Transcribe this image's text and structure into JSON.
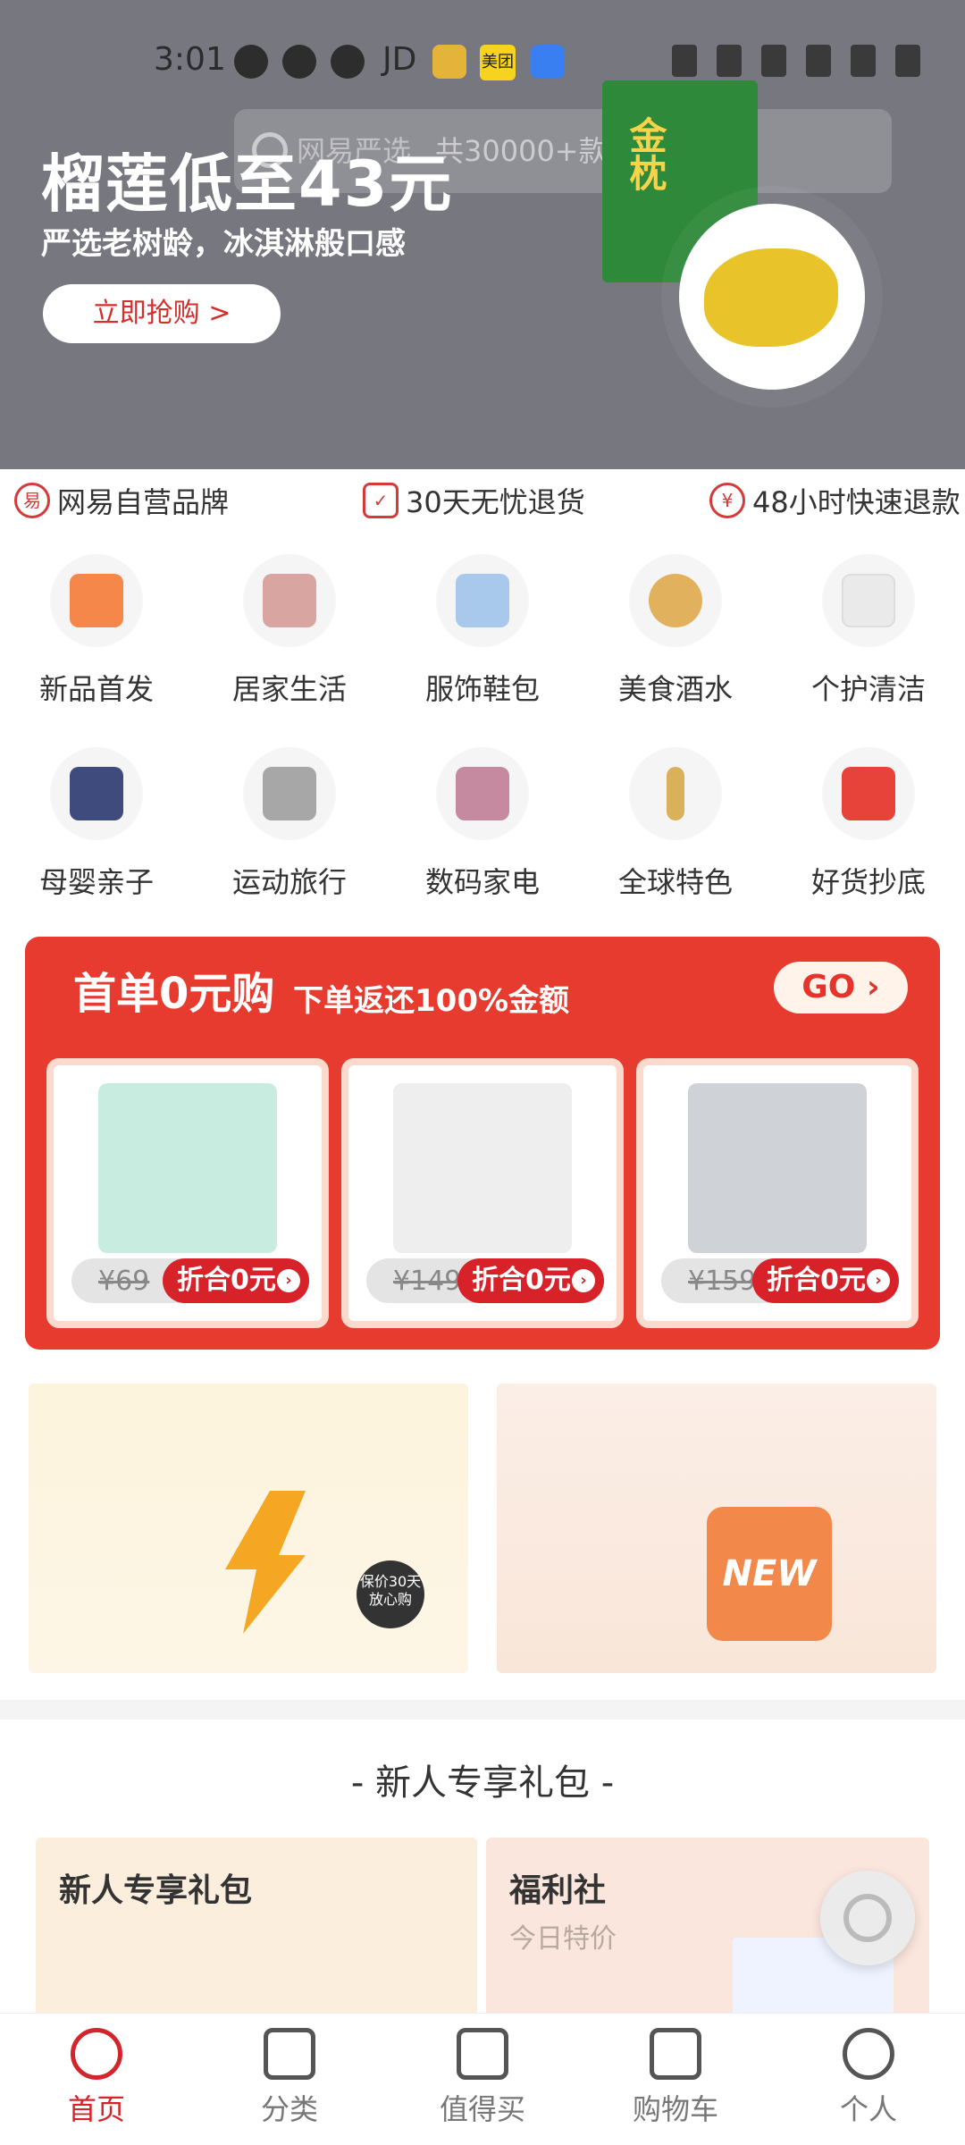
{
  "status_bar": {
    "time": "3:01",
    "app_label_jd": "JD",
    "app_label_meituan": "美团"
  },
  "banner": {
    "search_faded": "网易严选",
    "search_placeholder": "共30000+款好物",
    "title": "榴莲低至43元",
    "subtitle": "严选老树龄，冰淇淋般口感",
    "cta": "立即抢购 >",
    "product_text": "金枕"
  },
  "guarantees": [
    {
      "icon": "brand-icon",
      "text": "网易自营品牌"
    },
    {
      "icon": "shield-check-icon",
      "text": "30天无忧退货"
    },
    {
      "icon": "yen-icon",
      "text": "48小时快速退款"
    }
  ],
  "categories": [
    {
      "label": "新品首发",
      "color": "#f5874a",
      "icon": "new-bag-icon"
    },
    {
      "label": "居家生活",
      "color": "#d9a5a1",
      "icon": "bed-icon"
    },
    {
      "label": "服饰鞋包",
      "color": "#a8c8ec",
      "icon": "shirt-icon"
    },
    {
      "label": "美食酒水",
      "color": "#e2b15e",
      "icon": "food-bowl-icon"
    },
    {
      "label": "个护清洁",
      "color": "#eaeaea",
      "icon": "tissue-icon"
    },
    {
      "label": "母婴亲子",
      "color": "#3f4b7d",
      "icon": "backpack-icon"
    },
    {
      "label": "运动旅行",
      "color": "#a7a7a7",
      "icon": "suitcase-icon"
    },
    {
      "label": "数码家电",
      "color": "#c58aa0",
      "icon": "appliance-icon"
    },
    {
      "label": "全球特色",
      "color": "#d8b15a",
      "icon": "beauty-roller-icon"
    },
    {
      "label": "好货抄底",
      "color": "#e8433b",
      "icon": "flash-sale-icon"
    }
  ],
  "promo": {
    "title": "首单0元购",
    "subtitle": "下单返还100%金额",
    "go": "GO",
    "items": [
      {
        "old_price": "¥69",
        "badge": "折合0元",
        "color": "#c9ece0"
      },
      {
        "old_price": "¥149",
        "badge": "折合0元",
        "color": "#eeeeee"
      },
      {
        "old_price": "¥159",
        "badge": "折合0元",
        "color": "#cfd2d6"
      }
    ]
  },
  "tiles": {
    "badge": "保价30天放心购",
    "bag_text": "NEW"
  },
  "gift_section": {
    "title": "- 新人专享礼包 -",
    "card1_title": "新人专享礼包",
    "card2_title": "福利社",
    "card2_sub": "今日特价"
  },
  "tabbar": [
    {
      "label": "首页",
      "icon": "home-icon",
      "active": true
    },
    {
      "label": "分类",
      "icon": "category-icon",
      "active": false
    },
    {
      "label": "值得买",
      "icon": "thumbs-up-icon",
      "active": false
    },
    {
      "label": "购物车",
      "icon": "cart-icon",
      "active": false
    },
    {
      "label": "个人",
      "icon": "person-icon",
      "active": false
    }
  ],
  "colors": {
    "accent": "#d4252c",
    "promo_bg": "#e63b2e"
  }
}
